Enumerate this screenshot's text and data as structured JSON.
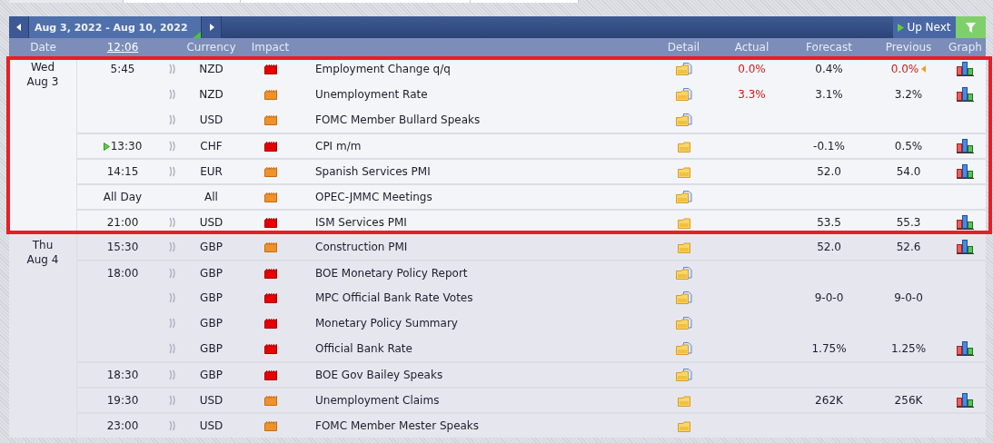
{
  "calendar": {
    "range": "Aug 3, 2022 - Aug 10, 2022",
    "up_next_button": "Up Next",
    "columns": {
      "date": "Date",
      "time": "12:06",
      "currency": "Currency",
      "impact": "Impact",
      "detail": "Detail",
      "actual": "Actual",
      "forecast": "Forecast",
      "previous": "Previous",
      "graph": "Graph"
    },
    "days": [
      {
        "weekday": "Wed",
        "date": "Aug 3",
        "highlighted": true,
        "events": [
          {
            "time": "5:45",
            "up_next": false,
            "alert": true,
            "currency": "NZD",
            "high_impact": true,
            "event": "Employment Change q/q",
            "memo": true,
            "actual": "0.0%",
            "actual_worse": true,
            "forecast": "0.4%",
            "previous": "0.0%",
            "previous_worse": true,
            "revised": true,
            "graph": true
          },
          {
            "up_next": false,
            "alert": true,
            "currency": "NZD",
            "high_impact": false,
            "event": "Unemployment Rate",
            "memo": true,
            "actual": "3.3%",
            "actual_worse": true,
            "forecast": "3.1%",
            "previous": "3.2%",
            "previous_worse": false,
            "revised": false,
            "graph": true
          },
          {
            "up_next": false,
            "alert": true,
            "currency": "USD",
            "high_impact": false,
            "event": "FOMC Member Bullard Speaks",
            "memo": true,
            "revised": false,
            "graph": false
          },
          {
            "time": "13:30",
            "up_next": true,
            "alert": true,
            "currency": "CHF",
            "high_impact": true,
            "event": "CPI m/m",
            "memo": false,
            "forecast": "-0.1%",
            "previous": "0.5%",
            "previous_worse": false,
            "revised": false,
            "graph": true
          },
          {
            "time": "14:15",
            "up_next": false,
            "alert": true,
            "currency": "EUR",
            "high_impact": false,
            "event": "Spanish Services PMI",
            "memo": false,
            "forecast": "52.0",
            "previous": "54.0",
            "previous_worse": false,
            "revised": false,
            "graph": true
          },
          {
            "time": "All Day",
            "up_next": false,
            "alert": false,
            "currency": "All",
            "high_impact": false,
            "event": "OPEC-JMMC Meetings",
            "memo": true,
            "revised": false,
            "graph": false
          },
          {
            "time": "21:00",
            "up_next": false,
            "alert": true,
            "currency": "USD",
            "high_impact": true,
            "event": "ISM Services PMI",
            "memo": false,
            "forecast": "53.5",
            "previous": "55.3",
            "previous_worse": false,
            "revised": false,
            "graph": true
          }
        ]
      },
      {
        "weekday": "Thu",
        "date": "Aug 4",
        "highlighted": false,
        "events": [
          {
            "time": "15:30",
            "up_next": false,
            "alert": true,
            "currency": "GBP",
            "high_impact": false,
            "event": "Construction PMI",
            "memo": false,
            "forecast": "52.0",
            "previous": "52.6",
            "previous_worse": false,
            "revised": false,
            "graph": true
          },
          {
            "time": "18:00",
            "up_next": false,
            "alert": true,
            "currency": "GBP",
            "high_impact": true,
            "event": "BOE Monetary Policy Report",
            "memo": true,
            "revised": false,
            "graph": false
          },
          {
            "up_next": false,
            "alert": true,
            "currency": "GBP",
            "high_impact": true,
            "event": "MPC Official Bank Rate Votes",
            "memo": true,
            "forecast": "9-0-0",
            "previous": "9-0-0",
            "previous_worse": false,
            "revised": false,
            "graph": false
          },
          {
            "up_next": false,
            "alert": true,
            "currency": "GBP",
            "high_impact": true,
            "event": "Monetary Policy Summary",
            "memo": true,
            "revised": false,
            "graph": false
          },
          {
            "up_next": false,
            "alert": true,
            "currency": "GBP",
            "high_impact": true,
            "event": "Official Bank Rate",
            "memo": true,
            "forecast": "1.75%",
            "previous": "1.25%",
            "previous_worse": false,
            "revised": false,
            "graph": true
          },
          {
            "time": "18:30",
            "up_next": false,
            "alert": true,
            "currency": "GBP",
            "high_impact": true,
            "event": "BOE Gov Bailey Speaks",
            "memo": true,
            "revised": false,
            "graph": false
          },
          {
            "time": "19:30",
            "up_next": false,
            "alert": true,
            "currency": "USD",
            "high_impact": false,
            "event": "Unemployment Claims",
            "memo": false,
            "forecast": "262K",
            "previous": "256K",
            "previous_worse": false,
            "revised": false,
            "graph": true
          },
          {
            "time": "23:00",
            "up_next": false,
            "alert": true,
            "currency": "USD",
            "high_impact": false,
            "event": "FOMC Member Mester Speaks",
            "memo": false,
            "revised": false,
            "graph": false
          }
        ]
      }
    ]
  }
}
